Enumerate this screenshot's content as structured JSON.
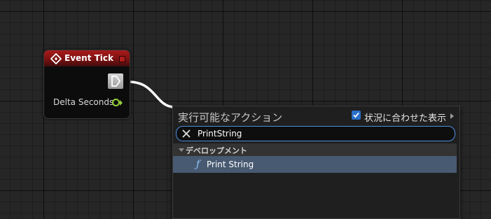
{
  "event_node": {
    "title": "Event Tick",
    "output_label": "Delta Seconds",
    "title_icon": "event-diamond-icon",
    "output_pin_icon": "float-pin-icon",
    "exec_pin_icon": "exec-pin-icon",
    "header_color": "#a91b1b"
  },
  "action_menu": {
    "title": "実行可能なアクション",
    "context_sensitive": {
      "label": "状況に合わせた表示",
      "checked": true
    },
    "search": {
      "value": "PrintString",
      "placeholder": ""
    },
    "categories": [
      {
        "label": "デベロップメント",
        "expanded": true,
        "items": [
          {
            "label": "Print String",
            "icon": "function-icon",
            "selected": true
          }
        ]
      }
    ],
    "accent_color": "#4d90e6",
    "selection_color": "#485a71"
  }
}
